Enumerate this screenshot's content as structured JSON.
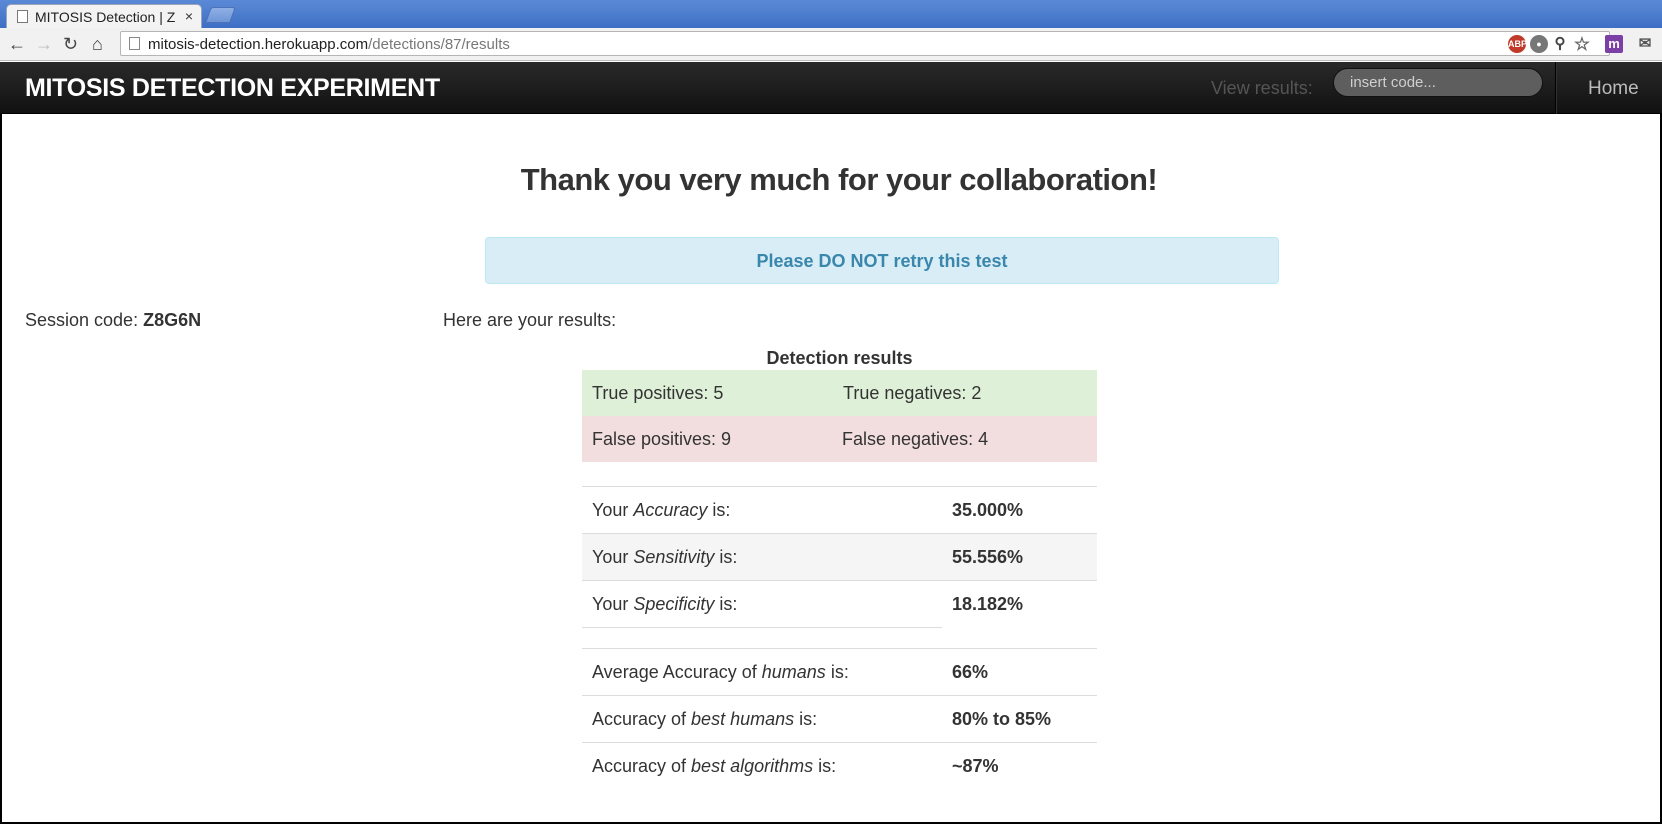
{
  "browser": {
    "tab_title": "MITOSIS Detection | Z",
    "tab_close": "×",
    "url_host": "mitosis-detection.herokuapp.com",
    "url_path": "/detections/87/results",
    "icons": [
      "back-icon",
      "forward-icon",
      "reload-icon",
      "home-icon",
      "adblock-icon",
      "bulb-icon",
      "zoom-icon",
      "star-icon",
      "extension-m-icon",
      "gmail-icon"
    ]
  },
  "navbar": {
    "brand": "MITOSIS DETECTION EXPERIMENT",
    "view_results_label": "View results:",
    "code_placeholder": "insert code...",
    "home_label": "Home"
  },
  "main": {
    "heading": "Thank you very much for your collaboration!",
    "alert_text": "Please DO NOT retry this test",
    "session_label": "Session code: ",
    "session_code": "Z8G6N",
    "results_intro": "Here are your results:"
  },
  "detection": {
    "title": "Detection results",
    "true_positives": "True positives: 5",
    "true_negatives": "True negatives: 2",
    "false_positives": "False positives: 9",
    "false_negatives": "False negatives: 4"
  },
  "metrics": [
    {
      "prefix": "Your ",
      "emph": "Accuracy",
      "suffix": " is:",
      "value": "35.000%"
    },
    {
      "prefix": "Your ",
      "emph": "Sensitivity",
      "suffix": " is:",
      "value": "55.556%"
    },
    {
      "prefix": "Your ",
      "emph": "Specificity",
      "suffix": " is:",
      "value": "18.182%"
    }
  ],
  "comparisons": [
    {
      "prefix": "Average Accuracy of ",
      "emph": "humans",
      "suffix": " is:",
      "value": "66%"
    },
    {
      "prefix": "Accuracy of ",
      "emph": "best humans",
      "suffix": " is:",
      "value": "80% to 85%"
    },
    {
      "prefix": "Accuracy of ",
      "emph": "best algorithms",
      "suffix": " is:",
      "value": "~87%"
    }
  ],
  "colors": {
    "alert_bg": "#d9edf7",
    "alert_text": "#3a87ad",
    "success_bg": "#dff0d8",
    "danger_bg": "#f2dede"
  }
}
